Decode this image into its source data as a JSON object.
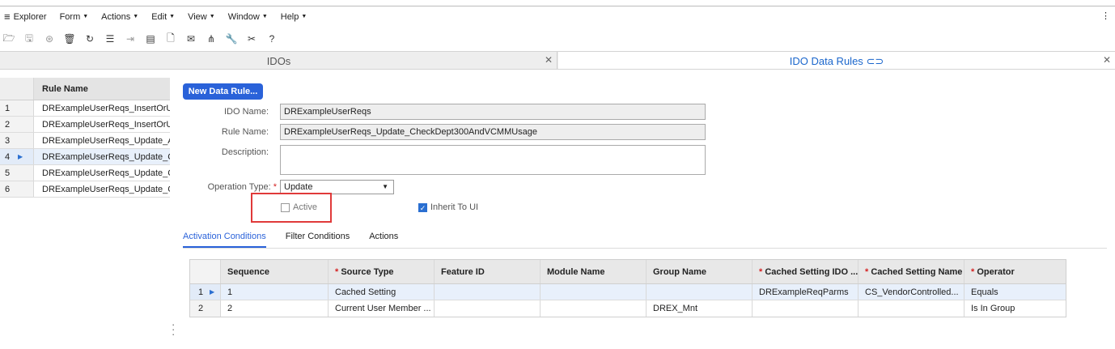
{
  "menu": {
    "explorer": "Explorer",
    "items": [
      "Form",
      "Actions",
      "Edit",
      "View",
      "Window",
      "Help"
    ],
    "overflow_icon": "vertical-ellipsis-icon"
  },
  "toolbar": {
    "icons": [
      "open-folder-icon",
      "save-icon",
      "cancel-icon",
      "delete-icon",
      "refresh-icon",
      "filter-icon",
      "filter-in-place-icon",
      "notes-icon",
      "new-document-icon",
      "email-icon",
      "org-chart-icon",
      "tools-icon",
      "tools-cross-icon",
      "help-icon"
    ]
  },
  "tabs": {
    "idos": "IDOs",
    "rules": "IDO Data Rules"
  },
  "rule_list": {
    "header": "Rule Name",
    "rows": [
      {
        "num": "1",
        "name": "DRExampleUserReqs_InsertOrUp"
      },
      {
        "num": "2",
        "name": "DRExampleUserReqs_InsertOrUp"
      },
      {
        "num": "3",
        "name": "DRExampleUserReqs_Update_Ap"
      },
      {
        "num": "4",
        "name": "DRExampleUserReqs_Update_Ch"
      },
      {
        "num": "5",
        "name": "DRExampleUserReqs_Update_Ch"
      },
      {
        "num": "6",
        "name": "DRExampleUserReqs_Update_Ch"
      }
    ]
  },
  "form": {
    "new_button": "New Data Rule...",
    "ido_label": "IDO Name:",
    "ido_value": "DRExampleUserReqs",
    "rule_label": "Rule Name:",
    "rule_value": "DRExampleUserReqs_Update_CheckDept300AndVCMMUsage",
    "desc_label": "Description:",
    "desc_value": "",
    "op_label": "Operation Type:",
    "op_value": "Update",
    "active_label": "Active",
    "active_checked": false,
    "inherit_label": "Inherit To UI",
    "inherit_checked": true
  },
  "subtabs": [
    "Activation Conditions",
    "Filter Conditions",
    "Actions"
  ],
  "conditions": {
    "headers": [
      "Sequence",
      "Source Type",
      "Feature ID",
      "Module Name",
      "Group Name",
      "Cached Setting IDO ...",
      "Cached Setting Name",
      "Operator"
    ],
    "rows": [
      {
        "num": "1",
        "cells": [
          "1",
          "Cached Setting",
          "",
          "",
          "",
          "DRExampleReqParms",
          "CS_VendorControlled...",
          "Equals"
        ]
      },
      {
        "num": "2",
        "cells": [
          "2",
          "Current User Member ...",
          "",
          "",
          "DREX_Mnt",
          "",
          "",
          "Is In Group"
        ]
      }
    ]
  },
  "colors": {
    "accent": "#2a62d9",
    "highlight": "#e03a3a",
    "required": "#d42222"
  }
}
